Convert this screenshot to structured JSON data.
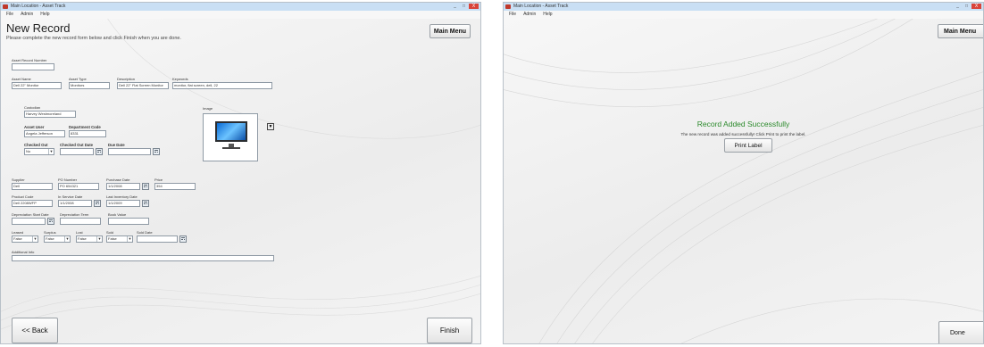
{
  "window1": {
    "title": "Main Location - Asset Track",
    "menu": [
      "File",
      "Admin",
      "Help"
    ],
    "heading": "New Record",
    "instructions": "Please complete the new record form below and click Finish when you are done.",
    "main_menu_label": "Main Menu",
    "back_label": "<< Back",
    "finish_label": "Finish",
    "form": {
      "asset_record_number_label": "Asset Record Number",
      "asset_record_number": "",
      "asset_name_label": "Asset Name",
      "asset_name": "Dell 22\" Monitor",
      "asset_type_label": "Asset Type",
      "asset_type": "Monitors",
      "description_label": "Description",
      "description": "Dell 22\" Flat Screen Monitor",
      "keywords_label": "Keywords",
      "keywords": "monitor, flat screen, dell, 22",
      "custodian_label": "Custodian",
      "custodian": "Harvey Westmoreland",
      "image_label": "Image",
      "asset_user_label": "Asset User",
      "asset_user": "Angela Jefferson",
      "department_code_label": "Department Code",
      "department_code": "8331",
      "checked_out_label": "Checked Out",
      "checked_out": "No",
      "checked_out_date_label": "Checked Out Date",
      "checked_out_date": "",
      "due_date_label": "Due Date",
      "due_date": "",
      "supplier_label": "Supplier",
      "supplier": "Dell",
      "po_number_label": "PO Number",
      "po_number": "PO 654321",
      "purchase_date_label": "Purchase Date",
      "purchase_date": "1/1/2008",
      "price_label": "Price",
      "price": "354",
      "product_code_label": "Product Code",
      "product_code": "Dell 2208WFP",
      "in_service_date_label": "In Service Date",
      "in_service_date": "1/1/2008",
      "last_inventory_date_label": "Last Inventory Date",
      "last_inventory_date": "1/1/2009",
      "depreciation_start_label": "Depreciation Start Date",
      "depreciation_start": "",
      "depreciation_term_label": "Depreciation Term",
      "depreciation_term": "",
      "book_value_label": "Book Value",
      "book_value": "",
      "leased_label": "Leased",
      "leased": "False",
      "surplus_label": "Surplus",
      "surplus": "False",
      "lost_label": "Lost",
      "lost": "False",
      "sold_label": "Sold",
      "sold": "False",
      "sold_date_label": "Sold Date",
      "sold_date": "",
      "additional_info_label": "Additional Info",
      "additional_info": ""
    }
  },
  "window2": {
    "title": "Main Location - Asset Track",
    "menu": [
      "File",
      "Admin",
      "Help"
    ],
    "main_menu_label": "Main Menu",
    "success_title": "Record Added Successfully",
    "success_message": "The new record was added successfully! Click Print to print the label.",
    "print_label": "Print Label",
    "done_label": "Done"
  },
  "icons": {
    "dropdown_arrow": "▼",
    "calendar": "calendar-icon",
    "minimize": "_",
    "maximize": "□",
    "close": "X"
  }
}
